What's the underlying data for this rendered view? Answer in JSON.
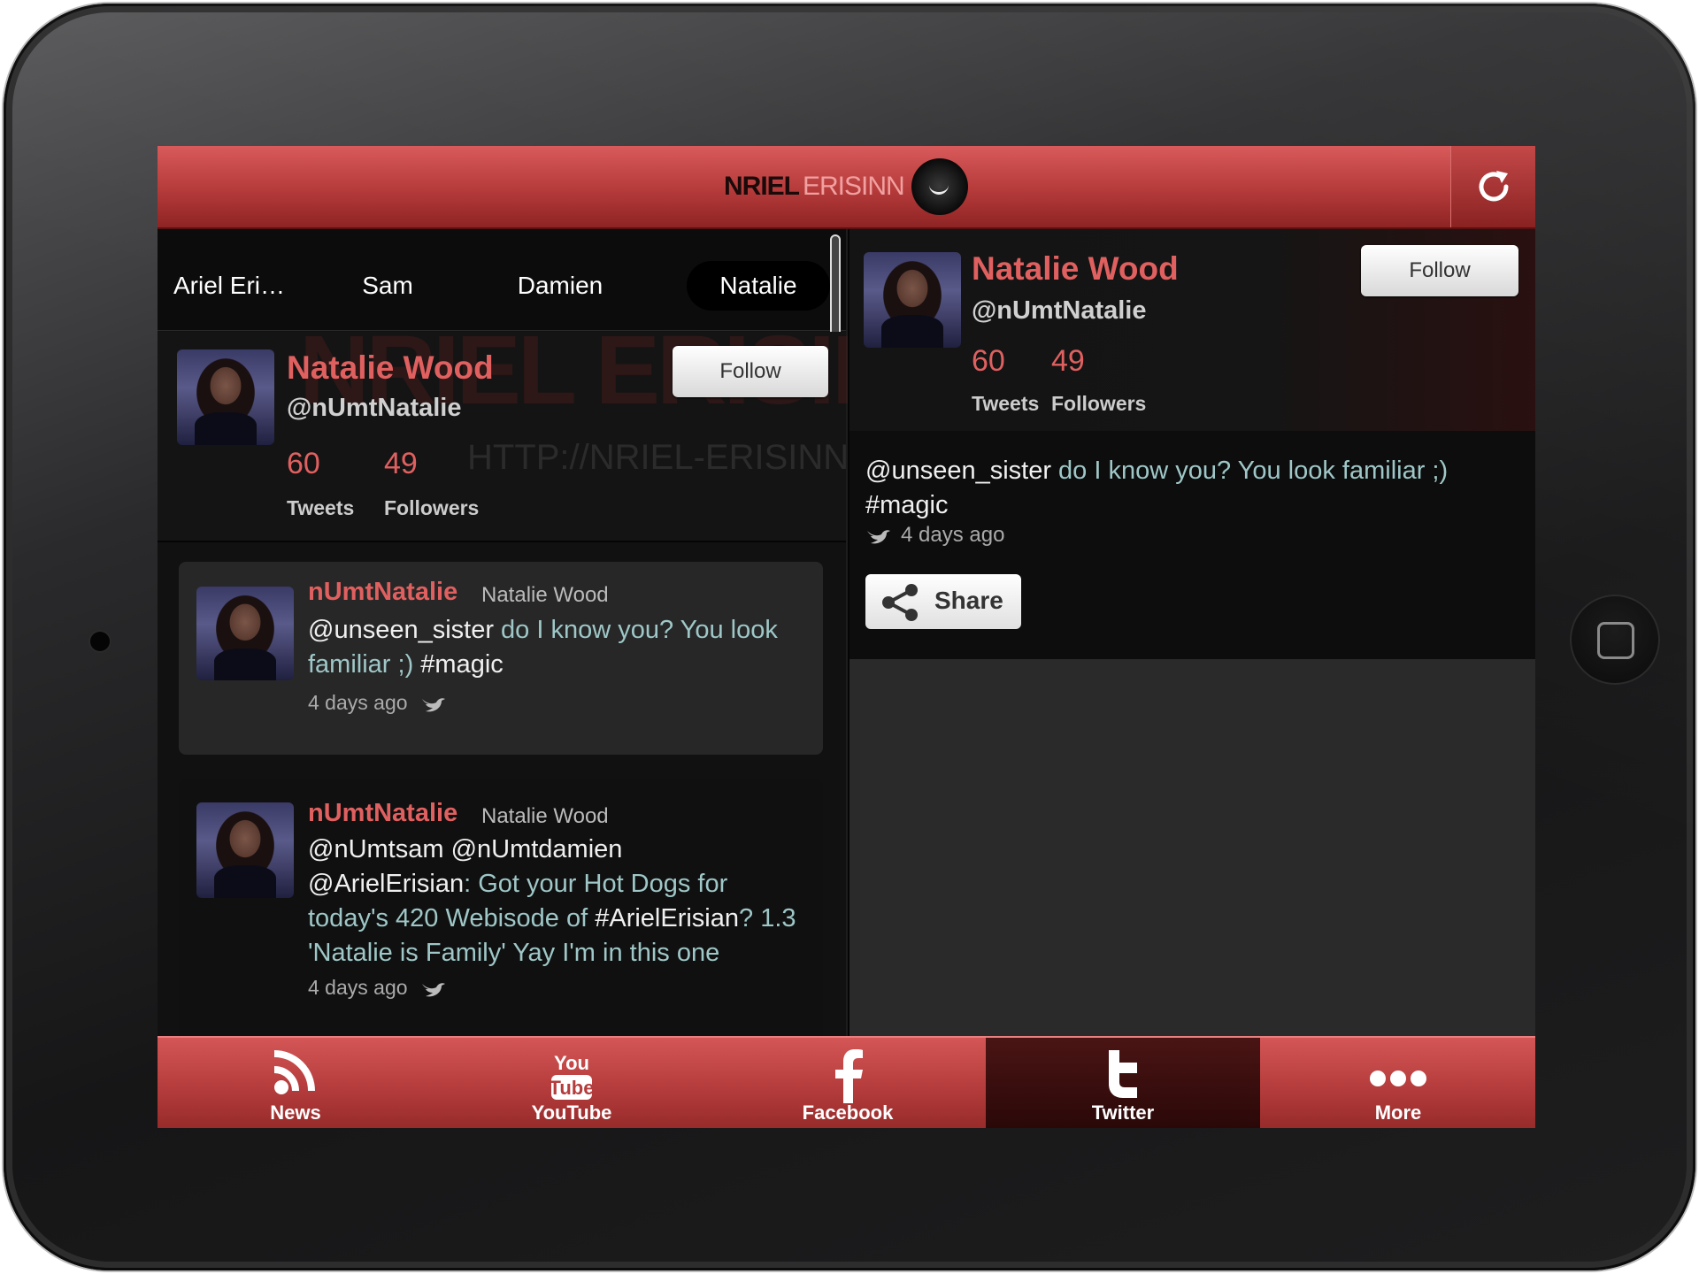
{
  "header": {
    "logo_text_1": "NRIEL",
    "logo_text_2": "ERISINN"
  },
  "tabs": [
    "Ariel Eri…",
    "Sam",
    "Damien",
    "Natalie"
  ],
  "left_profile": {
    "name": "Natalie Wood",
    "handle": "@nUmtNatalie",
    "tweets_count": "60",
    "tweets_label": "Tweets",
    "followers_count": "49",
    "followers_label": "Followers",
    "follow_label": "Follow",
    "watermark_text": "NRIEL ERISINN",
    "watermark_url": "HTTP://NRIEL-ERISINN.TK"
  },
  "feed": [
    {
      "user": "nUmtNatalie",
      "name": "Natalie Wood",
      "mention": "@unseen_sister",
      "text": " do I know you? You look familiar ;) ",
      "tag": "#magic",
      "time": "4 days ago"
    },
    {
      "user": "nUmtNatalie",
      "name": "Natalie Wood",
      "line1": "@nUmtsam @nUmtdamien",
      "line2_mention": "@ArielErisian",
      "line2_text": ": Got your Hot Dogs for today's 420 Webisode of ",
      "line2_tag": "#ArielErisian",
      "line2_text2": "? 1.3 'Natalie is Family' Yay I'm in this one",
      "time": "4 days ago"
    }
  ],
  "right_profile": {
    "name": "Natalie Wood",
    "handle": "@nUmtNatalie",
    "tweets_count": "60",
    "tweets_label": "Tweets",
    "followers_count": "49",
    "followers_label": "Followers",
    "follow_label": "Follow"
  },
  "detail_tweet": {
    "mention": "@unseen_sister",
    "text": " do I know you? You look familiar ;) ",
    "tag": "#magic",
    "time": "4 days ago",
    "share_label": "Share"
  },
  "tabbar": [
    {
      "label": "News",
      "icon": "rss-icon"
    },
    {
      "label": "YouTube",
      "icon": "youtube-icon"
    },
    {
      "label": "Facebook",
      "icon": "facebook-icon"
    },
    {
      "label": "Twitter",
      "icon": "twitter-icon",
      "active": true
    },
    {
      "label": "More",
      "icon": "more-icon"
    }
  ],
  "colors": {
    "accent": "#e06060",
    "bar": "#b53c3c",
    "link_text": "#9fc7c7"
  }
}
